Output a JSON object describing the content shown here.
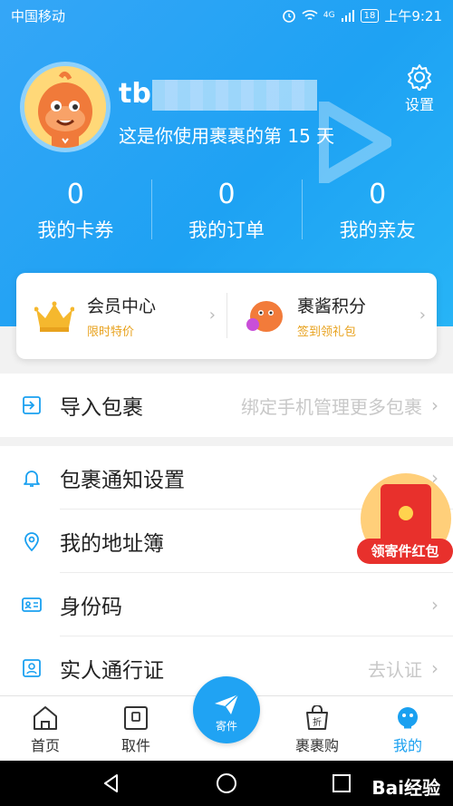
{
  "status": {
    "carrier": "中国移动",
    "battery": "18",
    "time": "上午9:21",
    "network": "4G"
  },
  "profile": {
    "username": "tb",
    "days_text": "这是你使用裹裹的第 15 天"
  },
  "settings": {
    "label": "设置"
  },
  "stats": [
    {
      "value": "0",
      "label": "我的卡券"
    },
    {
      "value": "0",
      "label": "我的订单"
    },
    {
      "value": "0",
      "label": "我的亲友"
    }
  ],
  "vip": [
    {
      "title": "会员中心",
      "sub": "限时特价"
    },
    {
      "title": "裹酱积分",
      "sub": "签到领礼包"
    }
  ],
  "menu": {
    "import": {
      "label": "导入包裹",
      "hint": "绑定手机管理更多包裹"
    },
    "notify": {
      "label": "包裹通知设置"
    },
    "address": {
      "label": "我的地址簿"
    },
    "idcode": {
      "label": "身份码"
    },
    "realname": {
      "label": "实人通行证",
      "hint": "去认证"
    }
  },
  "float_banner": {
    "label": "领寄件红包"
  },
  "tabs": [
    {
      "label": "首页"
    },
    {
      "label": "取件"
    },
    {
      "label": "寄件"
    },
    {
      "label": "裹裹购",
      "icon_text": "折"
    },
    {
      "label": "我的"
    }
  ],
  "watermark": "Bai经验"
}
